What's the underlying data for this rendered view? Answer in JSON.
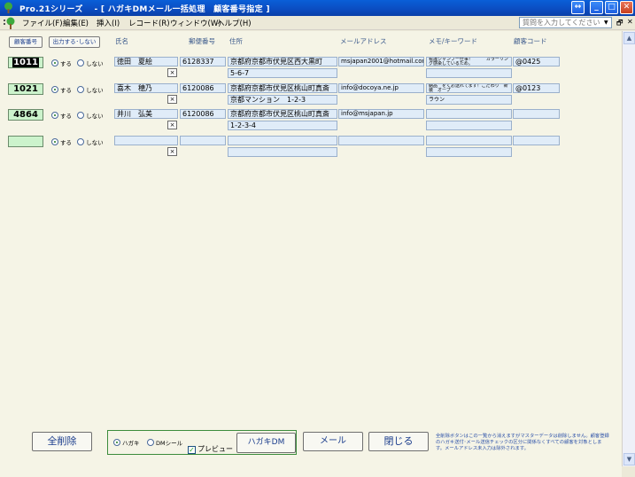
{
  "window": {
    "title": "Pro.21シリーズ　 - [ ハガキDMメール一括処理　顧客番号指定 ]"
  },
  "menu": {
    "items": [
      "ファイル(F)",
      "編集(E)",
      "挿入(I)",
      "レコード(R)",
      "ウィンドウ(W)",
      "ヘルプ(H)"
    ],
    "help_placeholder": "質問を入力してください"
  },
  "header": {
    "customer_no_button": "顧客番号",
    "output_button": "出力する･しない",
    "columns": {
      "name": "氏名",
      "postal": "郵便番号",
      "address": "住所",
      "email": "メールアドレス",
      "memo": "メモ/キーワード",
      "customer_code": "顧客コード"
    }
  },
  "radio_labels": {
    "on": "する",
    "off": "しない"
  },
  "rows": [
    {
      "no": "1011",
      "output": "on",
      "name": "徳田　夏絵",
      "postal": "6128337",
      "address1": "京都府京都市伏見区西大黒町",
      "address2": "5-6-7",
      "email": "msjapan2001@hotmail.com",
      "memo1": "看護シャンプー仕事！　　　カラーリング感染しているため。",
      "memo2": "",
      "code": "@0425"
    },
    {
      "no": "1021",
      "output": "on",
      "name": "喜木　穂乃",
      "postal": "6120086",
      "address1": "京都府京都市伏見区桃山町真斎",
      "address2": "京都マンション　1-2-3",
      "email": "info@docoya.ne.jp",
      "memo1": "納品　をくお送れてます！こだわり　新装　オープ",
      "memo2": "ラウン",
      "code": "@0123"
    },
    {
      "no": "4864",
      "output": "on",
      "name": "井川　弘美",
      "postal": "6120086",
      "address1": "京都府京都市伏見区桃山町真斎",
      "address2": "1-2-3-4",
      "email": "info@msjapan.jp",
      "memo1": "",
      "memo2": "",
      "code": ""
    },
    {
      "no": "",
      "output": "on",
      "name": "",
      "postal": "",
      "address1": "",
      "address2": "",
      "email": "",
      "memo1": "",
      "memo2": "",
      "code": ""
    }
  ],
  "footer": {
    "clear_all": "全削除",
    "mode_postcard": "ハガキ",
    "mode_dm_seal": "DMシール",
    "preview": "プレビュー",
    "postcard_dm": "ハガキDM",
    "mail": "メール",
    "close": "閉じる",
    "notice": "全削除ボタンはこの一覧から消えますがマスターデータは削除しません。顧客登録のハガキ送付･メール送信チェックの区分に関係なくすべての顧客を対象とします。メールアドレス未入力は除外されます。"
  },
  "colors": {
    "titlebar": "#0A5FD8",
    "number_field": "#CCF3CC",
    "data_field": "#E0ECF8",
    "group_border": "#3C8C3C"
  }
}
